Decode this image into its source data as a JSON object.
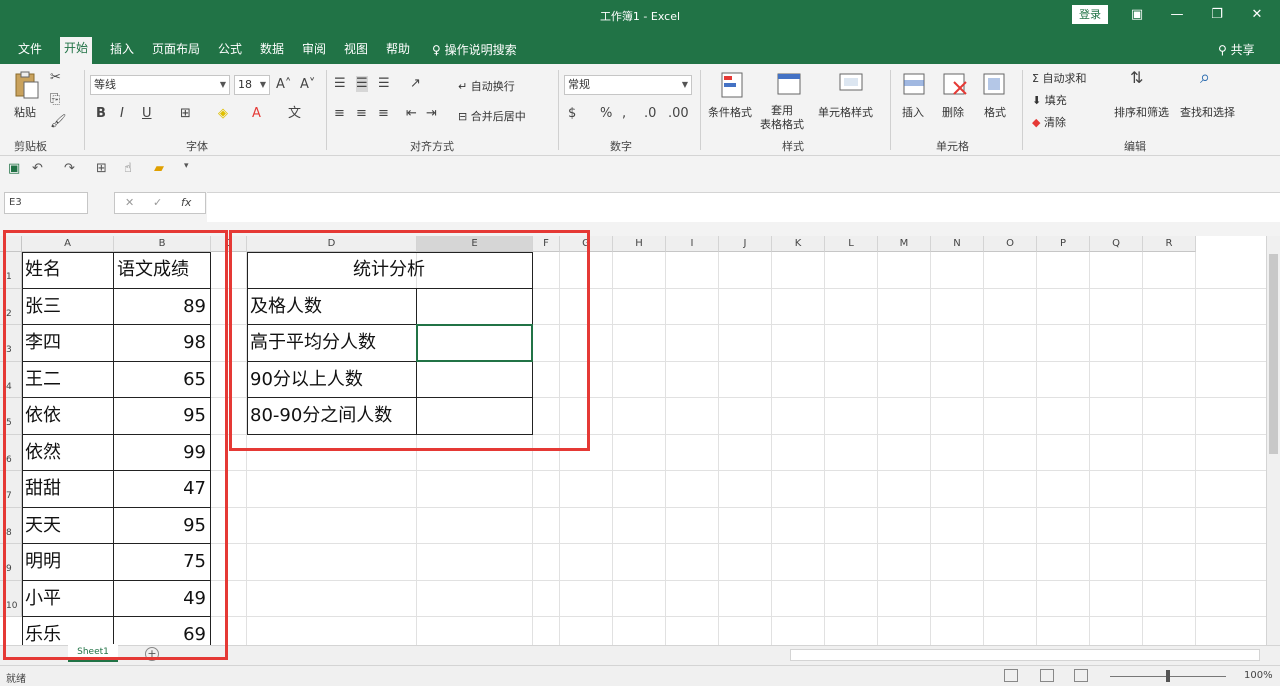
{
  "window": {
    "title": "工作簿1 - Excel",
    "login_label": "登录",
    "share_label": "共享"
  },
  "tabs": [
    {
      "label": "文件",
      "active": false
    },
    {
      "label": "开始",
      "active": true
    },
    {
      "label": "插入",
      "active": false
    },
    {
      "label": "页面布局",
      "active": false
    },
    {
      "label": "公式",
      "active": false
    },
    {
      "label": "数据",
      "active": false
    },
    {
      "label": "审阅",
      "active": false
    },
    {
      "label": "视图",
      "active": false
    },
    {
      "label": "帮助",
      "active": false
    }
  ],
  "tell_me": "操作说明搜索",
  "ribbon": {
    "paste_label": "粘贴",
    "font_name": "等线",
    "font_size": "18",
    "wrap_text": "自动换行",
    "merge_center": "合并后居中",
    "number_format": "常规",
    "conditional_format": "条件格式",
    "table_format": "套用\n表格格式",
    "cell_styles": "单元格样式",
    "insert": "插入",
    "delete": "删除",
    "format": "格式",
    "autosum": "自动求和",
    "fill": "填充",
    "clear": "清除",
    "sort_filter": "排序和筛选",
    "find_select": "查找和选择",
    "groups": {
      "clipboard": "剪贴板",
      "font": "字体",
      "alignment": "对齐方式",
      "number": "数字",
      "styles": "样式",
      "cells": "单元格",
      "editing": "编辑"
    }
  },
  "formula_bar": {
    "name_box": "E3",
    "fx": "fx"
  },
  "columns": [
    "A",
    "B",
    "C",
    "D",
    "E",
    "F",
    "G",
    "H",
    "I",
    "J",
    "K",
    "L",
    "M",
    "N",
    "O",
    "P",
    "Q",
    "R"
  ],
  "rows": [
    "1",
    "2",
    "3",
    "4",
    "5",
    "6",
    "7",
    "8",
    "9",
    "10"
  ],
  "table_left": {
    "header": [
      "姓名",
      "语文成绩"
    ],
    "rows": [
      [
        "张三",
        "89"
      ],
      [
        "李四",
        "98"
      ],
      [
        "王二",
        "65"
      ],
      [
        "依依",
        "95"
      ],
      [
        "依然",
        "99"
      ],
      [
        "甜甜",
        "47"
      ],
      [
        "天天",
        "95"
      ],
      [
        "明明",
        "75"
      ],
      [
        "小平",
        "49"
      ],
      [
        "乐乐",
        "69"
      ]
    ]
  },
  "table_right": {
    "title": "统计分析",
    "rows": [
      "及格人数",
      "高于平均分人数",
      "90分以上人数",
      "80-90分之间人数"
    ]
  },
  "sheet": {
    "tab_label": "Sheet1",
    "add_label": "+"
  },
  "status": {
    "ready": "就绪",
    "zoom": "100%"
  },
  "colors": {
    "accent": "#217346",
    "highlight": "#e53935"
  }
}
